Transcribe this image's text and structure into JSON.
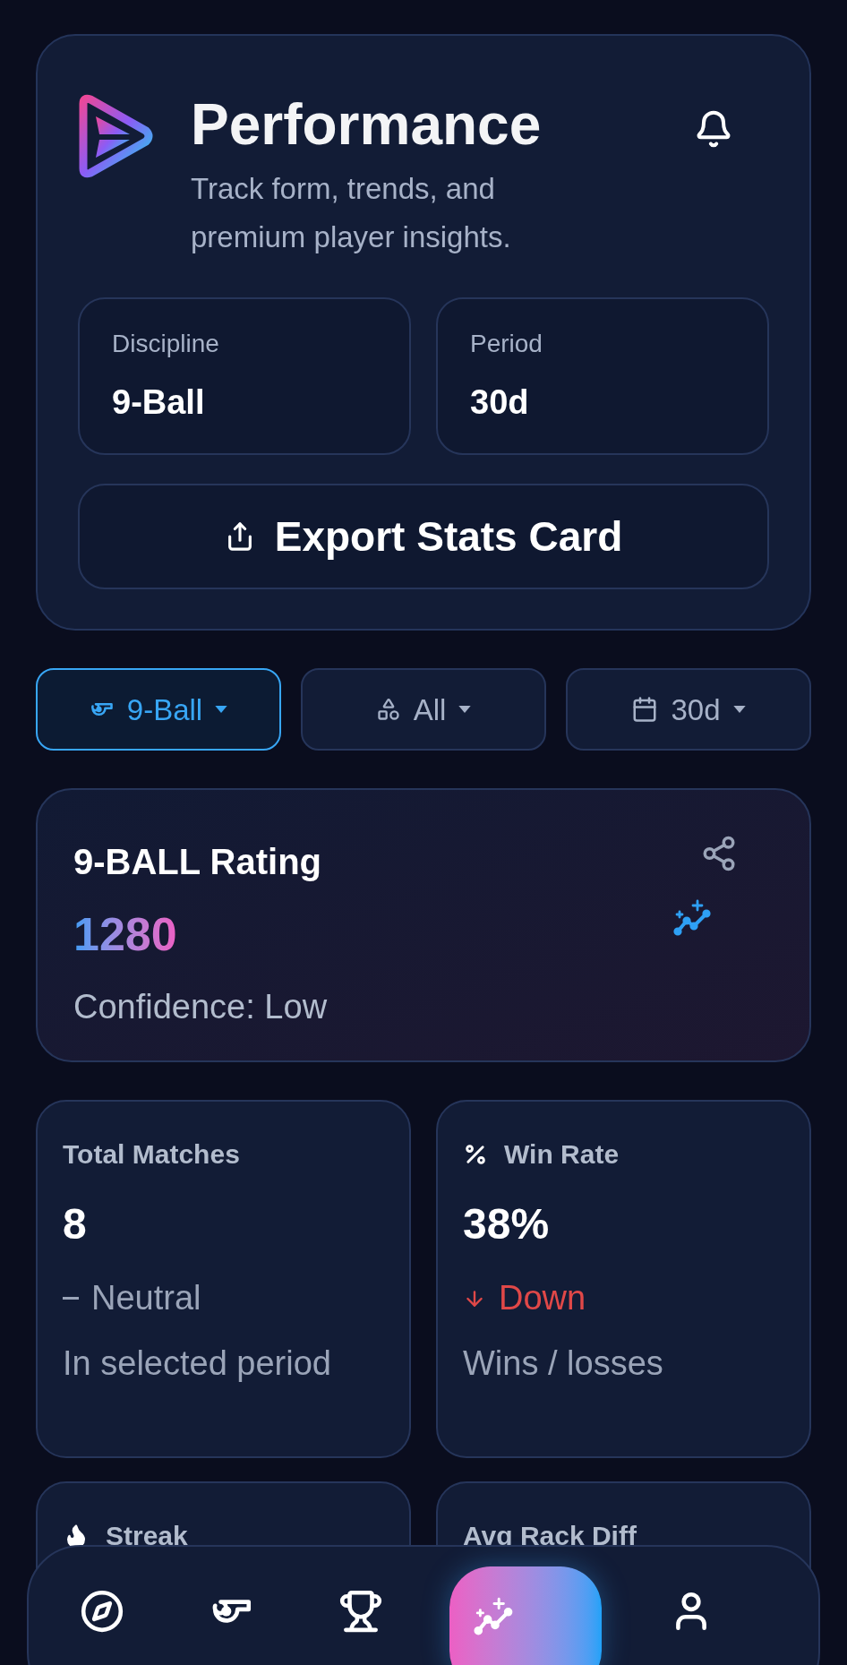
{
  "header": {
    "title": "Performance",
    "subtitle": "Track form, trends, and premium player insights.",
    "selectors": [
      {
        "label": "Discipline",
        "value": "9-Ball"
      },
      {
        "label": "Period",
        "value": "30d"
      }
    ],
    "export_button": "Export Stats Card"
  },
  "filters": [
    {
      "kind": "discipline",
      "label": "9-Ball",
      "selected": true
    },
    {
      "kind": "type",
      "label": "All",
      "selected": false
    },
    {
      "kind": "period",
      "label": "30d",
      "selected": false
    }
  ],
  "rating": {
    "title": "9-BALL Rating",
    "value": "1280",
    "confidence": "Confidence: Low"
  },
  "stats": [
    {
      "kind": "plain",
      "title": "Total Matches",
      "value": "8",
      "trend": {
        "kind": "neutral",
        "label": "Neutral"
      },
      "note": "In selected period"
    },
    {
      "kind": "percent",
      "title": "Win Rate",
      "value": "38%",
      "trend": {
        "kind": "down",
        "label": "Down"
      },
      "note": "Wins / losses"
    },
    {
      "kind": "flame",
      "title": "Streak"
    },
    {
      "kind": "plain",
      "title": "Avg Rack Diff"
    }
  ],
  "nav": [
    {
      "kind": "explore",
      "selected": false
    },
    {
      "kind": "whistle",
      "selected": false
    },
    {
      "kind": "trophy",
      "selected": false
    },
    {
      "kind": "analytics",
      "selected": true
    },
    {
      "kind": "profile",
      "selected": false
    }
  ]
}
